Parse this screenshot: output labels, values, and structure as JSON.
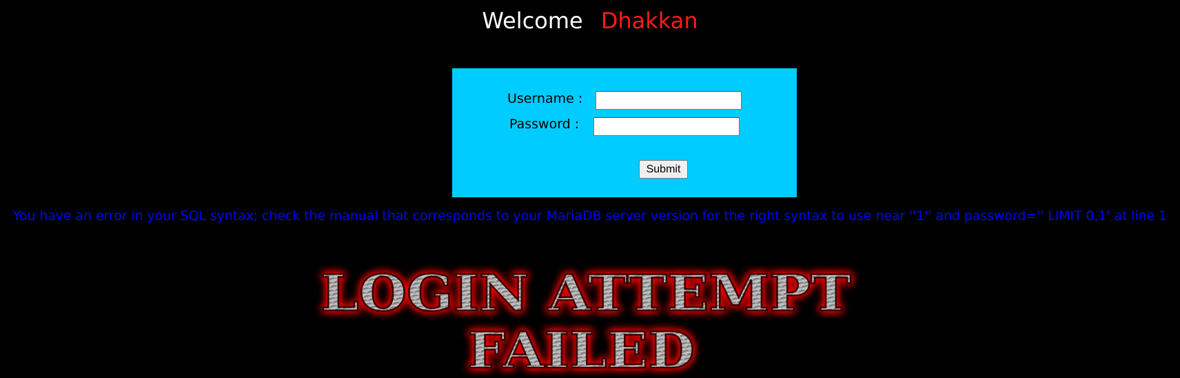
{
  "header": {
    "welcome_label": "Welcome",
    "user_name": "Dhakkan"
  },
  "login_form": {
    "username_label": "Username :",
    "password_label": "Password :",
    "username_value": "",
    "password_value": "",
    "submit_label": "Submit",
    "background_color": "#00ccff"
  },
  "error": {
    "message": "You have an error in your SQL syntax; check the manual that corresponds to your MariaDB server version for the right syntax to use near ''1'' and password='' LIMIT 0,1' at line 1",
    "color": "#0000ff"
  },
  "banner": {
    "line1": "LOGIN ATTEMPT",
    "line2": "FAILED",
    "glow_color": "#ff0000"
  }
}
